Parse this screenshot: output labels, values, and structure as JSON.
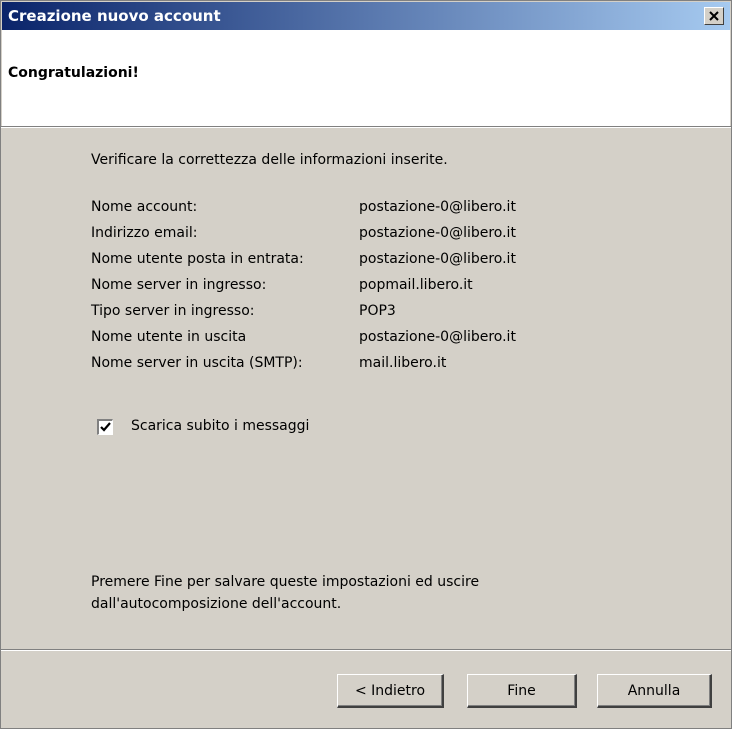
{
  "window": {
    "title": "Creazione nuovo account",
    "close_glyph": "✕"
  },
  "header": {
    "title": "Congratulazioni!"
  },
  "body": {
    "intro": "Verificare la correttezza delle informazioni inserite.",
    "rows": [
      {
        "label": "Nome account:",
        "value": "postazione-0@libero.it"
      },
      {
        "label": "Indirizzo email:",
        "value": "postazione-0@libero.it"
      },
      {
        "label": "Nome utente posta in entrata:",
        "value": "postazione-0@libero.it"
      },
      {
        "label": "Nome server in ingresso:",
        "value": "popmail.libero.it"
      },
      {
        "label": "Tipo server in ingresso:",
        "value": "POP3"
      },
      {
        "label": "Nome utente in uscita",
        "value": "postazione-0@libero.it"
      },
      {
        "label": "Nome server in uscita (SMTP):",
        "value": "mail.libero.it"
      }
    ],
    "download_checkbox": {
      "label": "Scarica subito i messaggi",
      "checked": true
    },
    "footer_text": "Premere Fine per salvare queste impostazioni ed uscire dall'autocomposizione dell'account."
  },
  "buttons": {
    "back": "< Indietro",
    "finish": "Fine",
    "cancel": "Annulla"
  }
}
